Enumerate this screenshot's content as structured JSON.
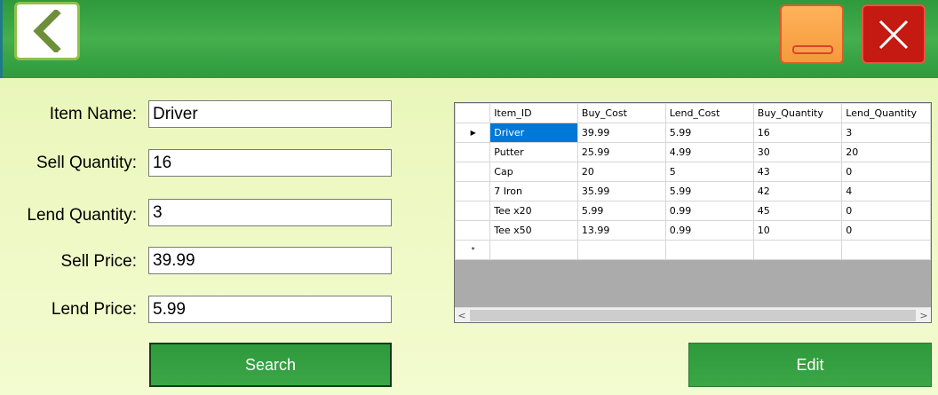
{
  "header": {
    "back_icon": "chevron-left-icon",
    "minimize_icon": "minimize-icon",
    "close_icon": "close-icon",
    "colors": {
      "header": "#3aa646",
      "back_border": "#8fc04a",
      "minimize": "#f59a3c",
      "close": "#c41a12"
    }
  },
  "form": {
    "item_name_label": "Item Name:",
    "item_name_value": "Driver",
    "sell_quantity_label": "Sell Quantity:",
    "sell_quantity_value": "16",
    "lend_quantity_label": "Lend Quantity:",
    "lend_quantity_value": "3",
    "sell_price_label": "Sell Price:",
    "sell_price_value": "39.99",
    "lend_price_label": "Lend Price:",
    "lend_price_value": "5.99"
  },
  "buttons": {
    "search_label": "Search",
    "edit_label": "Edit"
  },
  "grid": {
    "columns": [
      "Item_ID",
      "Buy_Cost",
      "Lend_Cost",
      "Buy_Quantity",
      "Lend_Quantity"
    ],
    "rows": [
      [
        "Driver",
        "39.99",
        "5.99",
        "16",
        "3"
      ],
      [
        "Putter",
        "25.99",
        "4.99",
        "30",
        "20"
      ],
      [
        "Cap",
        "20",
        "5",
        "43",
        "0"
      ],
      [
        "7 Iron",
        "35.99",
        "5.99",
        "42",
        "4"
      ],
      [
        "Tee x20",
        "5.99",
        "0.99",
        "45",
        "0"
      ],
      [
        "Tee x50",
        "13.99",
        "0.99",
        "10",
        "0"
      ]
    ],
    "current_row_marker": "▶",
    "new_row_marker": "*",
    "scroll_left": "<",
    "scroll_right": ">",
    "selection_color": "#0078d7"
  }
}
